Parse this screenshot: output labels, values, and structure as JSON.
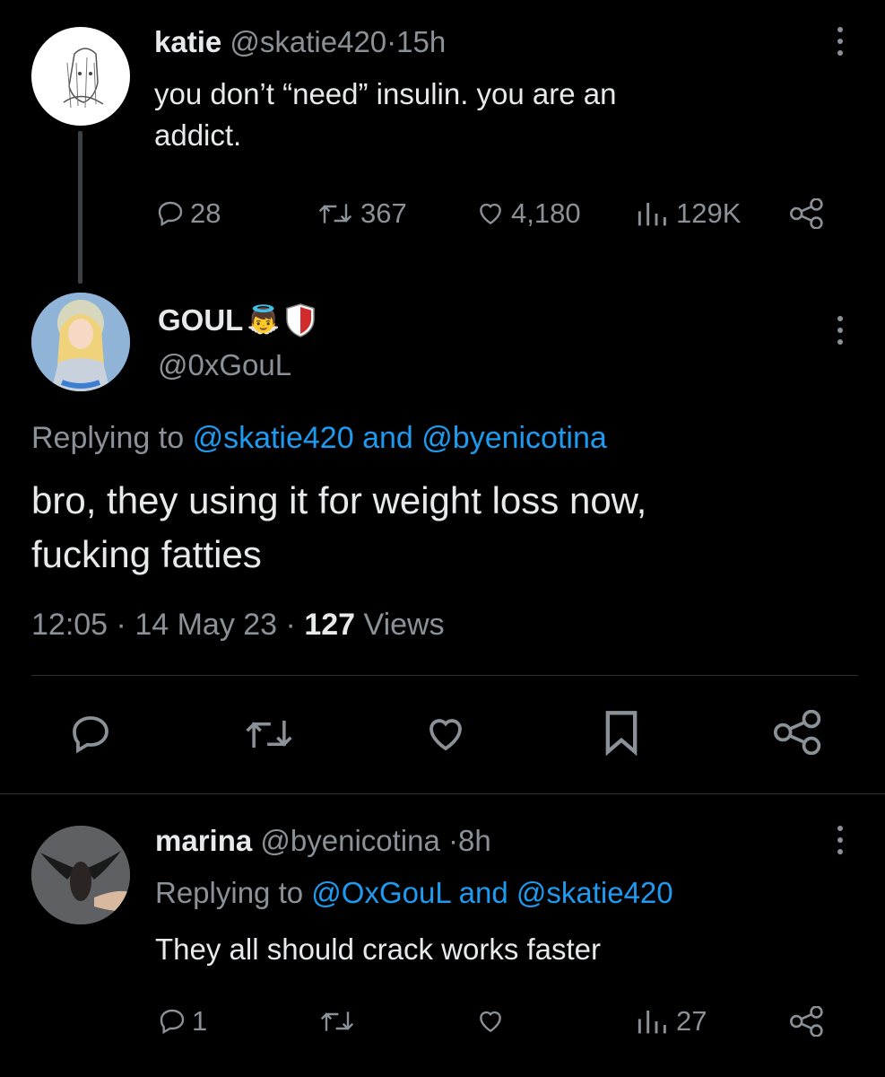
{
  "tweet1": {
    "name": "katie",
    "handle": "@skatie420",
    "sep": "·",
    "time": "15h",
    "text_line1": "you don’t “need” insulin. you are an",
    "text_line2": "addict.",
    "replies": "28",
    "retweets": "367",
    "likes": "4,180",
    "views": "129K"
  },
  "tweet2": {
    "name": "GOUL",
    "name_emoji": "👼",
    "handle": "@0xGouL",
    "replying_prefix": "Replying to",
    "replying_user1": "@skatie420",
    "replying_and": "and",
    "replying_user2": "@byenicotina",
    "text_line1": "bro, they using it for weight loss now,",
    "text_line2": "fucking fatties",
    "time": "12:05",
    "date": "14 May 23",
    "sep": "·",
    "views_count": "127",
    "views_label": "Views"
  },
  "tweet3": {
    "name": "marina",
    "handle": "@byenicotina",
    "sep": "·",
    "time": "8h",
    "replying_prefix": "Replying to",
    "replying_user1": "@OxGouL",
    "replying_and": "and",
    "replying_user2": "@skatie420",
    "text": "They all should crack works faster",
    "replies": "1",
    "views": "27"
  },
  "colors": {
    "background": "#000000",
    "text": "#e7e9ea",
    "muted": "#8b9198",
    "link": "#1d9bf0",
    "divider": "#2f3336"
  },
  "icons": [
    "more-icon",
    "reply-icon",
    "retweet-icon",
    "like-icon",
    "views-icon",
    "share-icon",
    "bookmark-icon",
    "shield-icon"
  ]
}
